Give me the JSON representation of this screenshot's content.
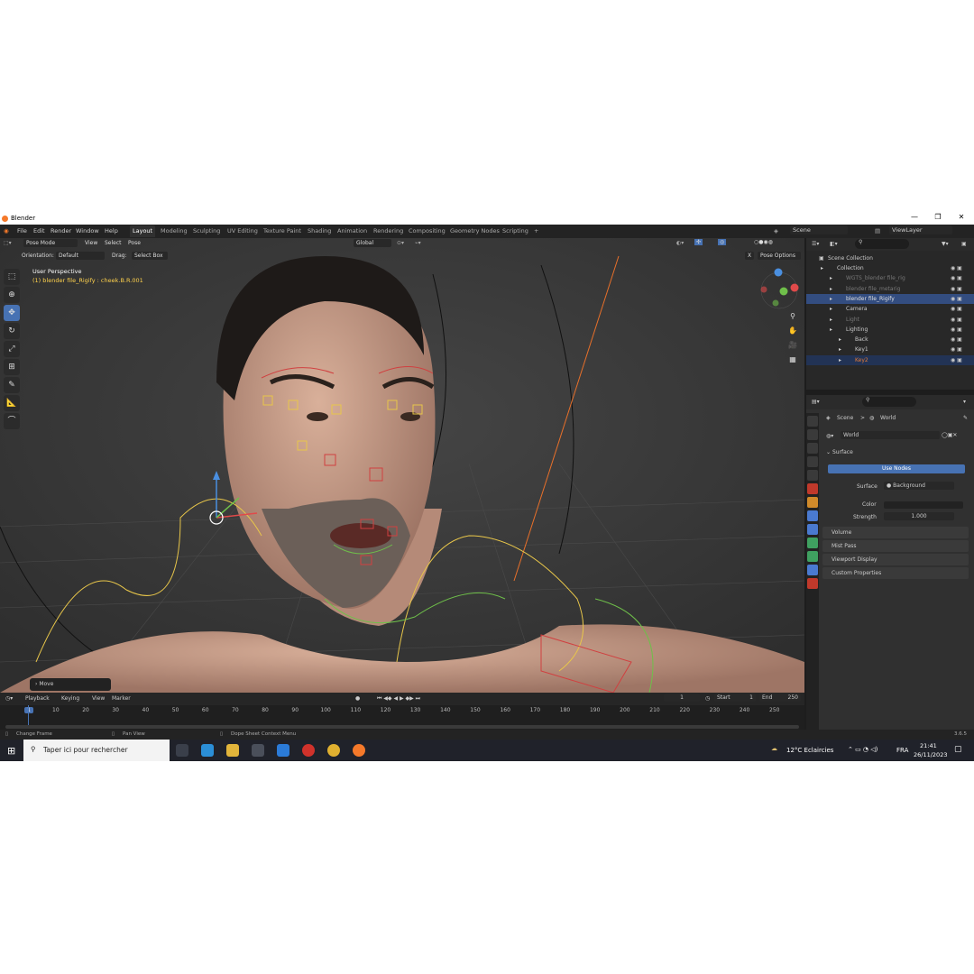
{
  "window": {
    "title": "Blender",
    "minimize": "—",
    "maximize": "❐",
    "close": "✕"
  },
  "menu": {
    "items": [
      "File",
      "Edit",
      "Render",
      "Window",
      "Help"
    ],
    "workspaces": [
      "Layout",
      "Modeling",
      "Sculpting",
      "UV Editing",
      "Texture Paint",
      "Shading",
      "Animation",
      "Rendering",
      "Compositing",
      "Geometry Nodes",
      "Scripting"
    ],
    "add": "+",
    "scene": "Scene",
    "view_layer": "ViewLayer"
  },
  "viewport": {
    "mode": "Pose Mode",
    "menus": [
      "View",
      "Select",
      "Pose"
    ],
    "transform": "Global",
    "orientation_label": "Orientation:",
    "orientation_value": "Default",
    "drag_label": "Drag:",
    "drag_value": "Select Box",
    "pose_options": "Pose Options",
    "x_label": "X",
    "perspective": "User Perspective",
    "selection": "(1) blender file_Rigify : cheek.B.R.001",
    "last_op": "Move"
  },
  "timeline": {
    "menus": [
      "Playback",
      "Keying",
      "View",
      "Marker"
    ],
    "current_frame": "1",
    "start_label": "Start",
    "start": "1",
    "end_label": "End",
    "end": "250",
    "ticks": [
      "1",
      "10",
      "20",
      "30",
      "40",
      "50",
      "60",
      "70",
      "80",
      "90",
      "100",
      "110",
      "120",
      "130",
      "140",
      "150",
      "160",
      "170",
      "180",
      "190",
      "200",
      "210",
      "220",
      "230",
      "240",
      "250"
    ]
  },
  "status": {
    "left": "Change Frame",
    "mid": "Pan View",
    "right": "Dope Sheet Context Menu",
    "version": "3.6.5"
  },
  "outliner": {
    "title": "Scene Collection",
    "rows": [
      {
        "label": "Collection",
        "indent": 1,
        "color": "#cccccc"
      },
      {
        "label": "WGTS_blender file_rig",
        "indent": 2,
        "color": "#777777"
      },
      {
        "label": "blender file_metarig",
        "indent": 2,
        "color": "#777777"
      },
      {
        "label": "blender file_Rigify",
        "indent": 2,
        "color": "#e0e0e0"
      },
      {
        "label": "Camera",
        "indent": 2,
        "color": "#cccccc"
      },
      {
        "label": "Light",
        "indent": 2,
        "color": "#777777"
      },
      {
        "label": "Lighting",
        "indent": 2,
        "color": "#cccccc"
      },
      {
        "label": "Back",
        "indent": 3,
        "color": "#cccccc"
      },
      {
        "label": "Key1",
        "indent": 3,
        "color": "#cccccc"
      },
      {
        "label": "Key2",
        "indent": 3,
        "color": "#e07a3a"
      }
    ]
  },
  "properties": {
    "breadcrumb_scene": "Scene",
    "breadcrumb_sep": ">",
    "breadcrumb_world": "World",
    "world_name": "World",
    "surface_panel": "Surface",
    "use_nodes": "Use Nodes",
    "surface_label": "Surface",
    "surface_value": "Background",
    "color_label": "Color",
    "strength_label": "Strength",
    "strength_value": "1.000",
    "panels": [
      "Volume",
      "Mist Pass",
      "Viewport Display",
      "Custom Properties"
    ]
  },
  "taskbar": {
    "search_placeholder": "Taper ici pour rechercher",
    "weather": "12°C  Eclaircies",
    "lang": "FRA",
    "time": "21:41",
    "date": "26/11/2023"
  }
}
